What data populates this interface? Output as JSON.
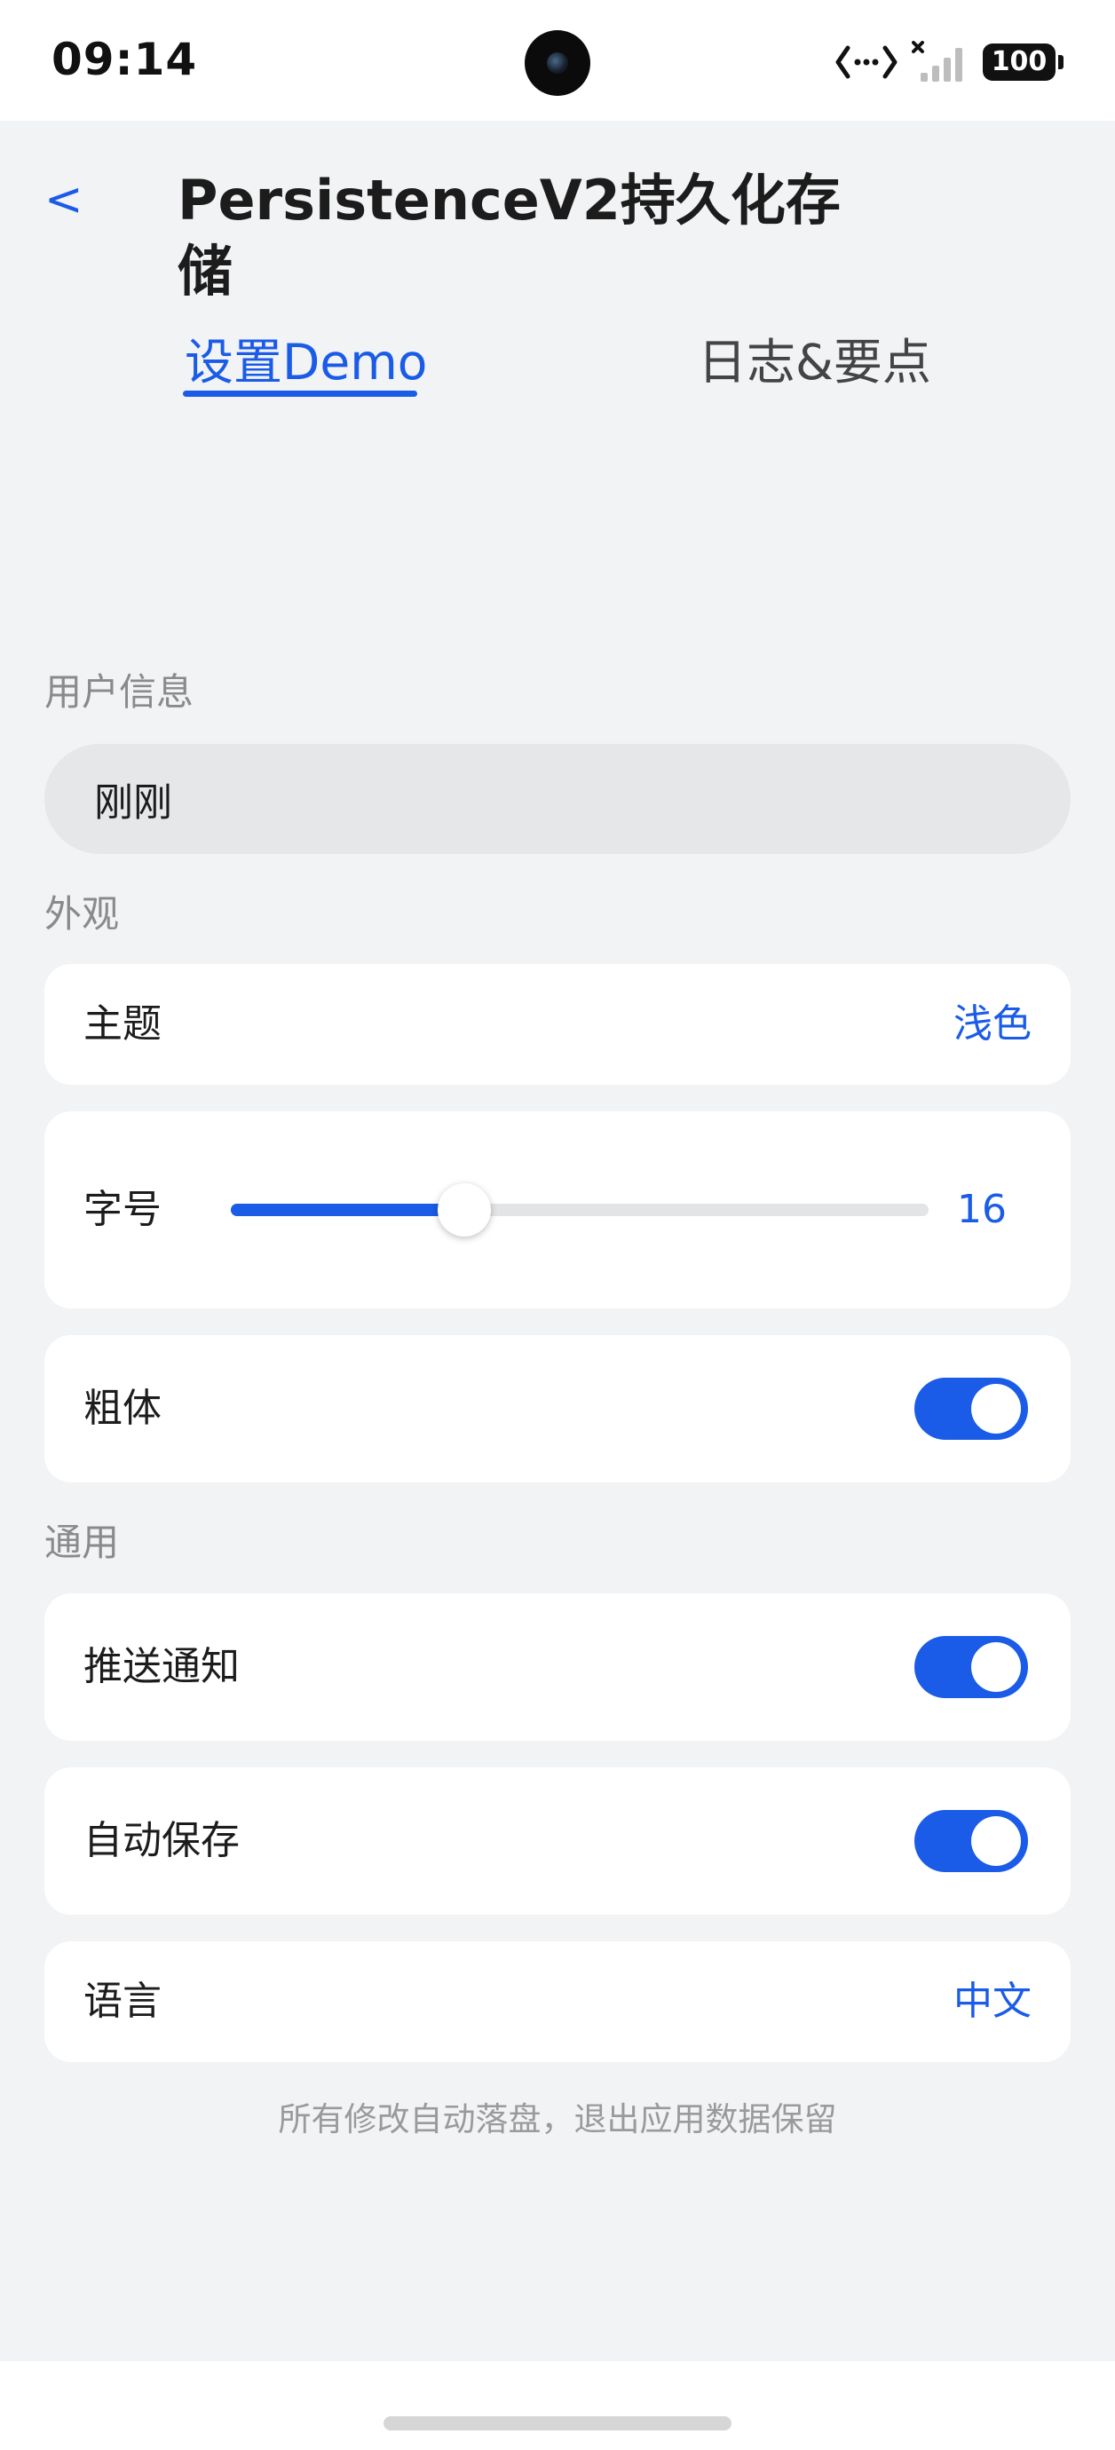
{
  "status_bar": {
    "time": "09:14",
    "battery": "100"
  },
  "header": {
    "back": "<",
    "title": "PersistenceV2持久化存储"
  },
  "tabs": [
    {
      "label": "设置Demo",
      "active": true
    },
    {
      "label": "日志&要点",
      "active": false
    }
  ],
  "sections": {
    "user_info": {
      "label": "用户信息",
      "input_value": "刚刚"
    },
    "appearance": {
      "label": "外观",
      "theme": {
        "label": "主题",
        "value": "浅色"
      },
      "font_size": {
        "label": "字号",
        "value": "16",
        "slider_fraction": 0.335
      },
      "bold": {
        "label": "粗体",
        "on": true
      }
    },
    "general": {
      "label": "通用",
      "push": {
        "label": "推送通知",
        "on": true
      },
      "autosave": {
        "label": "自动保存",
        "on": true
      },
      "language": {
        "label": "语言",
        "value": "中文"
      }
    }
  },
  "footer_note": "所有修改自动落盘，退出应用数据保留",
  "colors": {
    "accent": "#1a5be8",
    "background": "#f1f3f5",
    "card": "#ffffff"
  }
}
